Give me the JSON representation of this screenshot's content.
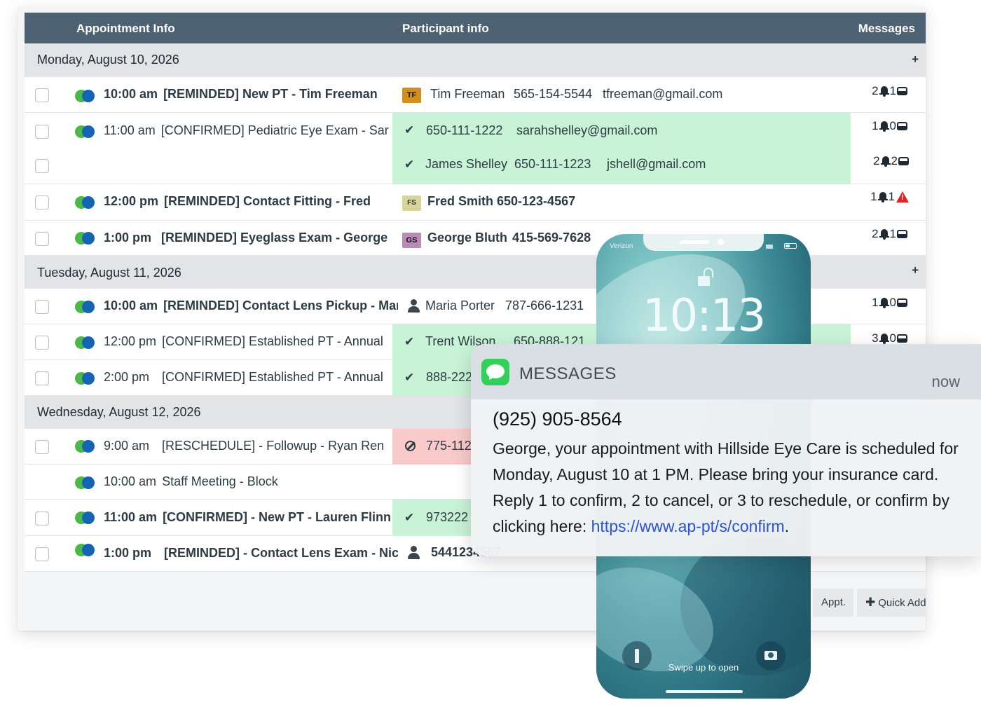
{
  "table": {
    "headers": {
      "appointment": "Appointment Info",
      "participant": "Participant info",
      "messages": "Messages"
    }
  },
  "days": [
    {
      "date": "Monday, August 10, 2026",
      "plus": "+",
      "rows": [
        {
          "time": "10:00 am",
          "title": "[REMINDED] New PT - Tim Freeman",
          "bold": true,
          "participant": {
            "initials": "TF",
            "name": "Tim Freeman",
            "phone": "565-154-5544",
            "email": "tfreeman@gmail.com"
          },
          "messages": {
            "a": "2",
            "b": "1"
          }
        },
        {
          "time": "11:00 am",
          "title": "[CONFIRMED] Pediatric Eye Exam - Sar",
          "bold": false,
          "participant": {
            "phone": "650-111-1222",
            "email": "sarahshelley@gmail.com"
          },
          "messages": {
            "a": "1",
            "b": "0"
          }
        },
        {
          "participant": {
            "name": "James Shelley",
            "phone": "650-111-1223",
            "email": "jshell@gmail.com"
          },
          "messages": {
            "a": "2",
            "b": "2"
          }
        },
        {
          "time": "12:00 pm",
          "title": "[REMINDED] Contact Fitting - Fred",
          "bold": true,
          "participant": {
            "initials": "FS",
            "name": "Fred Smith",
            "phone": "650-123-4567"
          },
          "messages": {
            "a": "1",
            "b": "1"
          }
        },
        {
          "time": "1:00 pm",
          "title": "[REMINDED] Eyeglass Exam - George",
          "bold": true,
          "participant": {
            "initials": "GS",
            "name": "George Bluth",
            "phone": "415-569-7628"
          },
          "messages": {
            "a": "2",
            "b": "1"
          }
        }
      ]
    },
    {
      "date": "Tuesday, August 11, 2026",
      "plus": "+",
      "rows": [
        {
          "time": "10:00 am",
          "title": "[REMINDED] Contact Lens Pickup - Mar",
          "bold": true,
          "participant": {
            "name": "Maria Porter",
            "phone": "787-666-1231"
          },
          "messages": {
            "a": "1",
            "b": "0"
          }
        },
        {
          "time": "12:00 pm",
          "title": "[CONFIRMED] Established PT - Annual",
          "bold": false,
          "participant": {
            "name": "Trent Wilson",
            "phone": "650-888-121"
          },
          "messages": {
            "a": "3",
            "b": "0"
          }
        },
        {
          "time": "2:00 pm",
          "title": "[CONFIRMED] Established PT - Annual",
          "bold": false,
          "participant": {
            "phone": "888-222"
          }
        }
      ]
    },
    {
      "date": "Wednesday, August 12, 2026",
      "rows": [
        {
          "time": "9:00 am",
          "title": "[RESCHEDULE] - Followup - Ryan Ren",
          "bold": false,
          "participant": {
            "phone": "775-112"
          }
        },
        {
          "time": "10:00 am",
          "title": "Staff Meeting - Block",
          "bold": false
        },
        {
          "time": "11:00 am",
          "title": "[CONFIRMED] - New PT - Lauren Flinn",
          "bold": true,
          "participant": {
            "phone": "973222"
          }
        },
        {
          "time": "1:00 pm",
          "title": "[REMINDED] - Contact Lens Exam - Nic",
          "bold": true,
          "participant": {
            "phone": "5441234567"
          }
        }
      ]
    }
  ],
  "footer": {
    "appt_label": "Appt.",
    "quick_add_label": "Quick Add"
  },
  "phone": {
    "carrier": "Verizon",
    "time": "10:13",
    "swipe_text": "Swipe up to open"
  },
  "notification": {
    "app": "MESSAGES",
    "when": "now",
    "sender": "(925) 905-8564",
    "body": "George, your appointment with Hillside Eye Care is scheduled for Monday, August 10 at 1 PM. Please bring your insurance card. Reply 1 to confirm, 2 to cancel, or 3 to reschedule, or confirm by clicking here: ",
    "link": "https://www.ap-pt/s/confirm",
    "after_link": ".",
    "colors": {
      "app_icon": "#2fd158",
      "link": "#2b52d6"
    }
  },
  "colors": {
    "header_bg": "#4d6272",
    "confirmed_bg": "#c9f3d7",
    "reschedule_bg": "#f9caca",
    "alert_red": "#e32222"
  }
}
